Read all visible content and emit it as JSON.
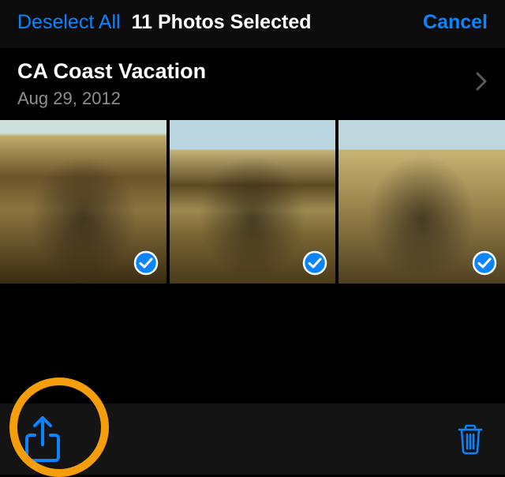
{
  "topbar": {
    "deselect_label": "Deselect All",
    "title": "11 Photos Selected",
    "cancel_label": "Cancel"
  },
  "album": {
    "title": "CA Coast Vacation",
    "date": "Aug 29, 2012"
  },
  "photos": [
    {
      "selected": true
    },
    {
      "selected": true
    },
    {
      "selected": true
    }
  ],
  "icons": {
    "chevron": "chevron-right-icon",
    "check": "checkmark-icon",
    "share": "share-icon",
    "trash": "trash-icon"
  },
  "colors": {
    "accent": "#0a84ff",
    "highlight": "#f59e0b"
  }
}
